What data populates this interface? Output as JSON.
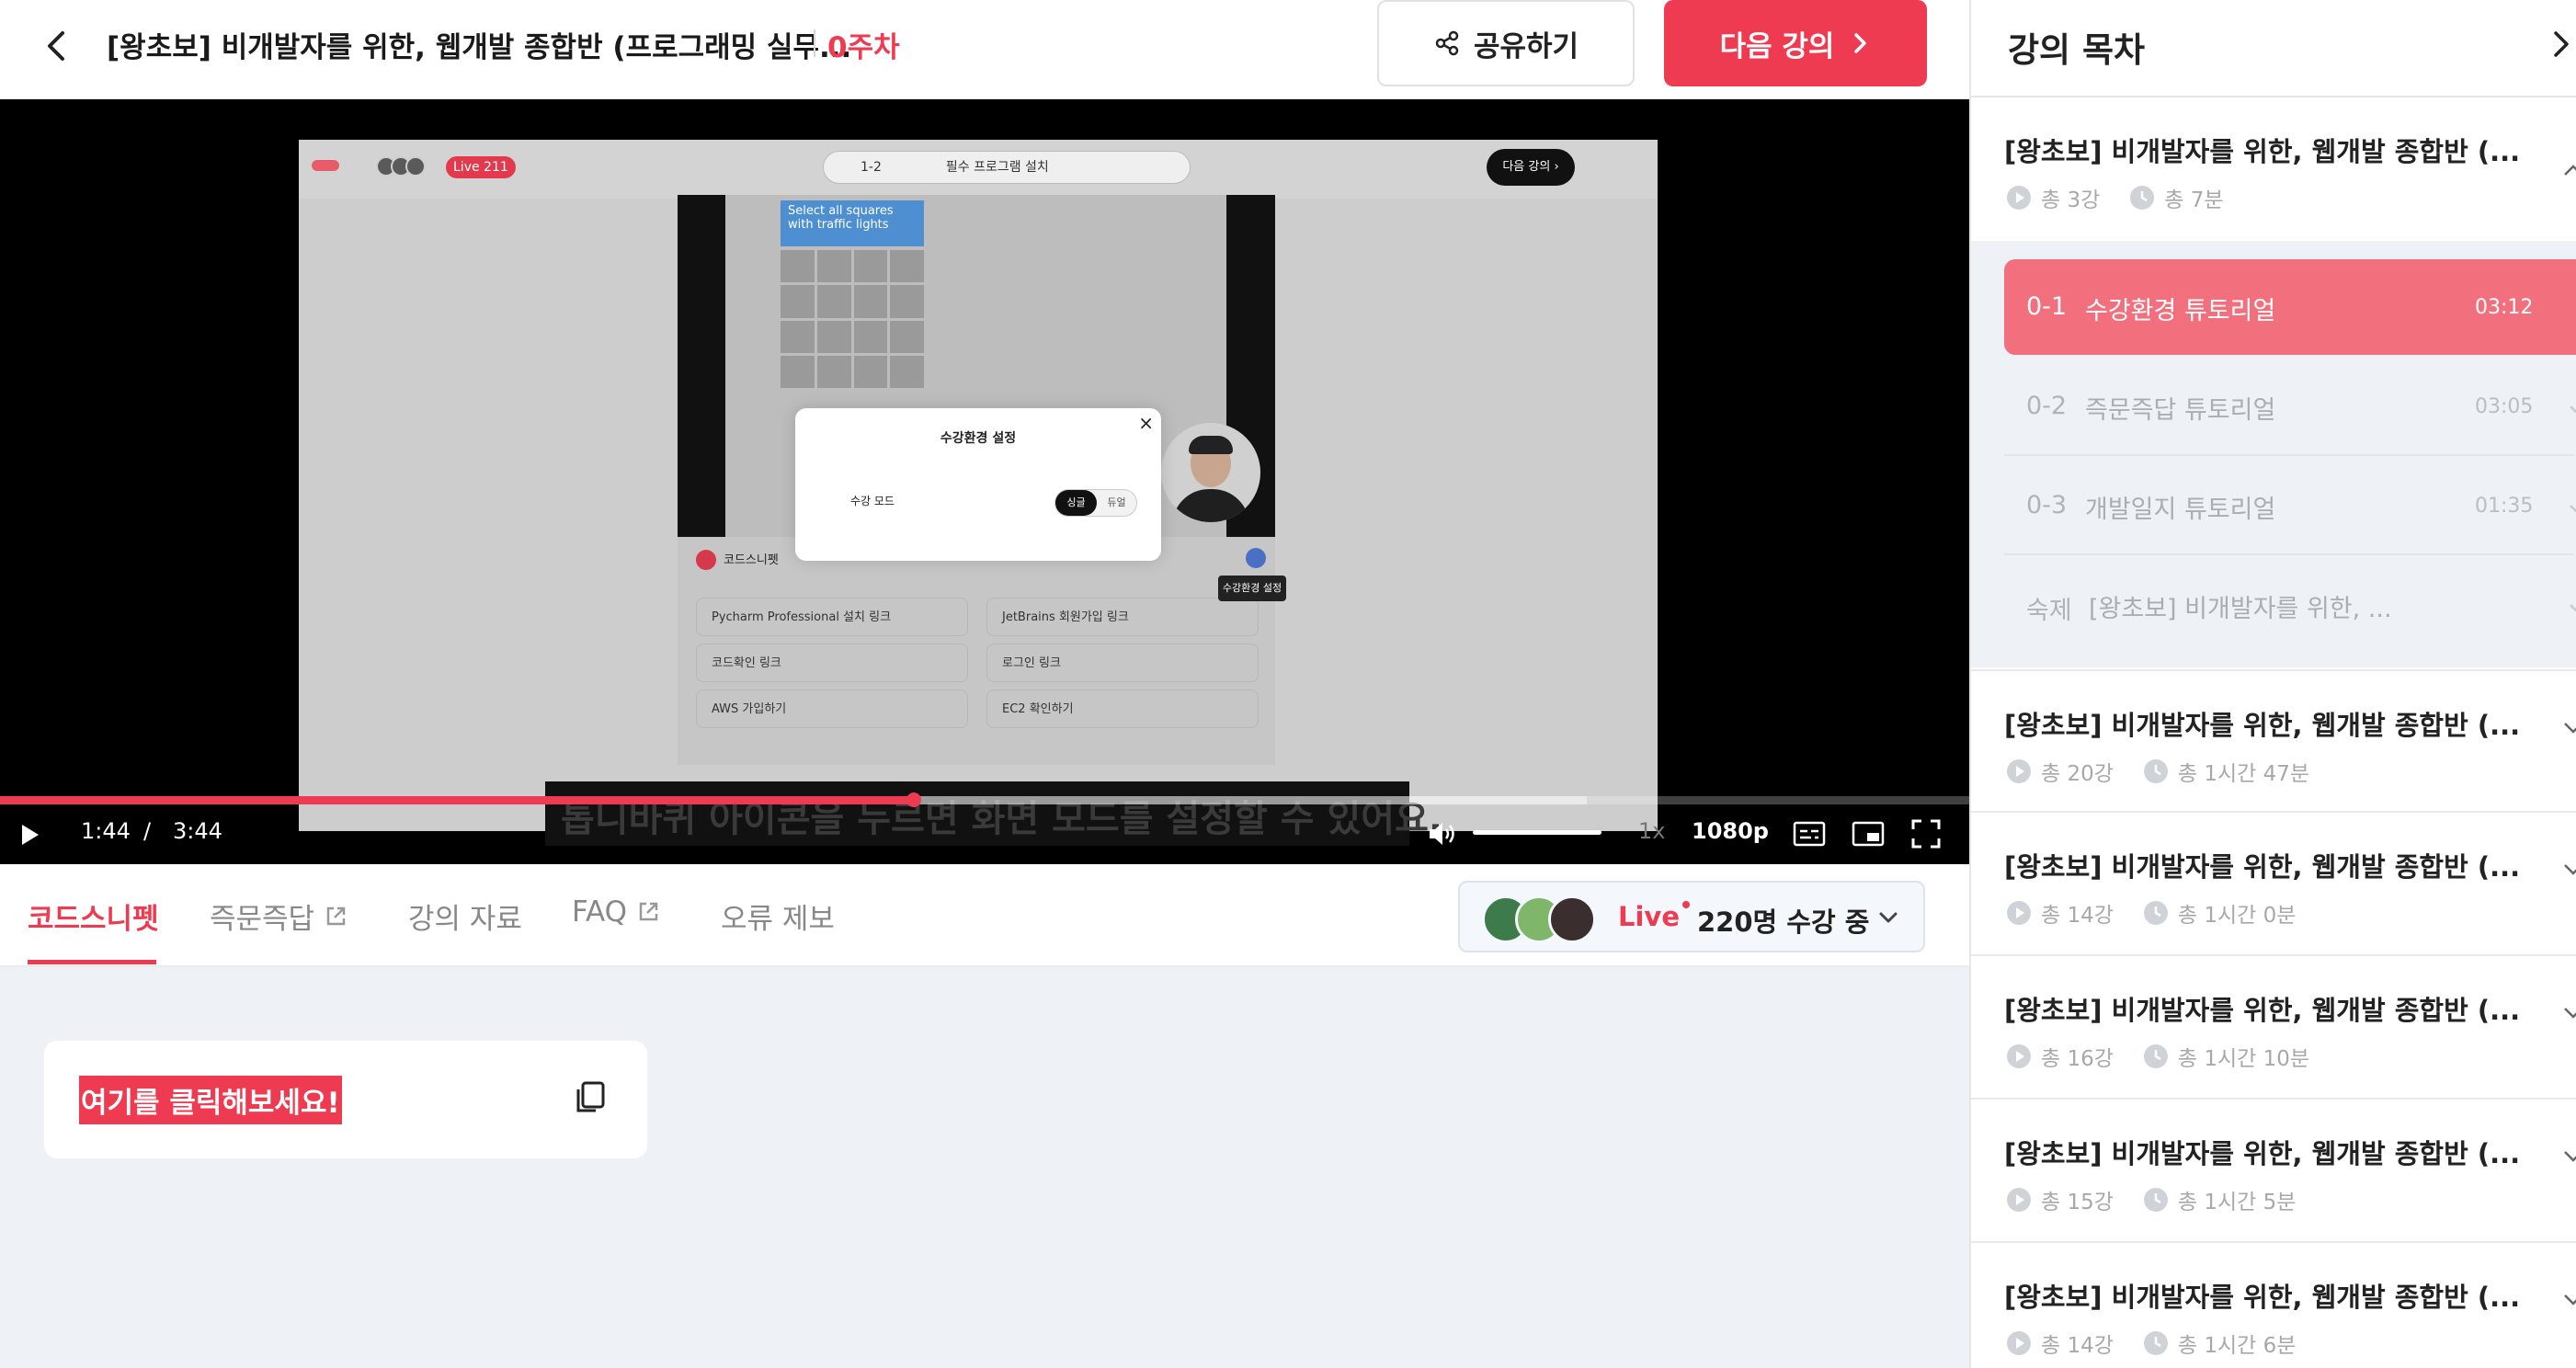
{
  "header": {
    "title": "[왕초보] 비개발자를 위한, 웹개발 종합반 (프로그래밍 실무...",
    "week": "0주차",
    "share_label": "공유하기",
    "next_label": "다음 강의"
  },
  "video": {
    "inner": {
      "live_label": "Live",
      "live_count": "211",
      "select_num": "1-2",
      "select_name": "필수 프로그램 설치",
      "next_label": "다음 강의 ›",
      "captcha_title": "Select all squares with traffic lights",
      "brand": "코드스니펫",
      "links": [
        "Pycharm Professional 설치 링크",
        "JetBrains 회원가입 링크",
        "코드확인 링크",
        "로그인 링크",
        "AWS 가입하기",
        "EC2 확인하기"
      ],
      "tooltip": "수강환경 설정",
      "modal_title": "수강환경 설정",
      "modal_label": "수강 모드",
      "toggle_on": "싱글",
      "toggle_off": "듀얼",
      "subtitle": "톱니바퀴 아이콘을 누르면 화면 모드를 설정할 수 있어요."
    },
    "current_time": "1:44",
    "separator": "/",
    "duration": "3:44",
    "progress": 0.464,
    "buffered": 0.806,
    "speed": "1x",
    "quality": "1080p"
  },
  "tabs": [
    {
      "label": "코드스니펫"
    },
    {
      "label": "즉문즉답"
    },
    {
      "label": "강의 자료"
    },
    {
      "label": "FAQ"
    },
    {
      "label": "오류 제보"
    }
  ],
  "live": {
    "label": "Live",
    "count_text": "220명 수강 중"
  },
  "snippet": {
    "text": "여기를 클릭해보세요!"
  },
  "sidebar": {
    "title": "강의 목차",
    "sections": [
      {
        "title": "[왕초보] 비개발자를 위한, 웹개발 종합반 (...",
        "count": "총 3강",
        "duration": "총 7분"
      },
      {
        "title": "[왕초보] 비개발자를 위한, 웹개발 종합반 (...",
        "count": "총 20강",
        "duration": "총 1시간 47분"
      },
      {
        "title": "[왕초보] 비개발자를 위한, 웹개발 종합반 (...",
        "count": "총 14강",
        "duration": "총 1시간 0분"
      },
      {
        "title": "[왕초보] 비개발자를 위한, 웹개발 종합반 (...",
        "count": "총 16강",
        "duration": "총 1시간 10분"
      },
      {
        "title": "[왕초보] 비개발자를 위한, 웹개발 종합반 (...",
        "count": "총 15강",
        "duration": "총 1시간 5분"
      },
      {
        "title": "[왕초보] 비개발자를 위한, 웹개발 종합반 (...",
        "count": "총 14강",
        "duration": "총 1시간 6분"
      }
    ],
    "lessons": [
      {
        "num": "0-1",
        "name": "수강환경 튜토리얼",
        "time": "03:12"
      },
      {
        "num": "0-2",
        "name": "즉문즉답 튜토리얼",
        "time": "03:05"
      },
      {
        "num": "0-3",
        "name": "개발일지 튜토리얼",
        "time": "01:35"
      },
      {
        "num": "숙제",
        "name": "[왕초보] 비개발자를 위한, ...",
        "time": ""
      }
    ]
  },
  "colors": {
    "accent": "#ef3b52",
    "active_lesson": "#f2707d",
    "content_bg": "#eef2f6"
  }
}
